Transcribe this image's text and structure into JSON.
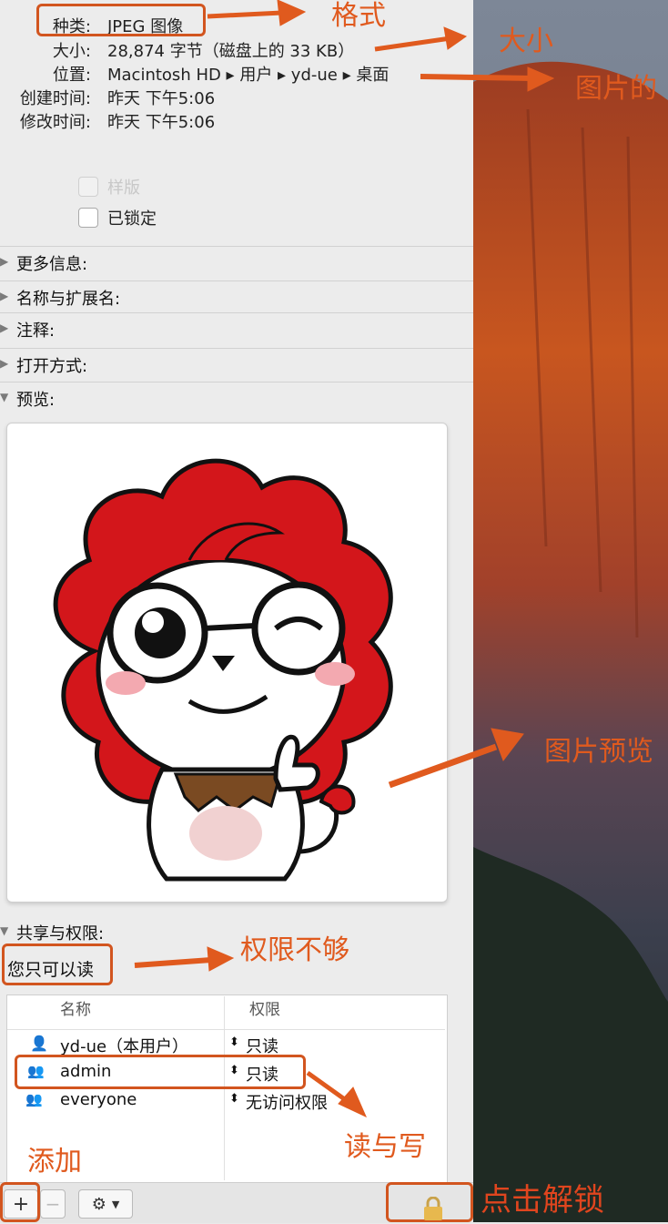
{
  "info": {
    "kind_label": "种类:",
    "kind_value": "JPEG 图像",
    "size_label": "大小:",
    "size_value": "28,874 字节（磁盘上的 33 KB）",
    "where_label": "位置:",
    "where_value": "Macintosh HD ▸ 用户 ▸ yd-ue ▸ 桌面",
    "created_label": "创建时间:",
    "created_value": "昨天 下午5:06",
    "modified_label": "修改时间:",
    "modified_value": "昨天 下午5:06"
  },
  "checks": {
    "stationery": "样版",
    "locked": "已锁定"
  },
  "sections": {
    "more_info": "更多信息:",
    "name_ext": "名称与扩展名:",
    "comments": "注释:",
    "open_with": "打开方式:",
    "preview": "预览:",
    "sharing": "共享与权限:"
  },
  "sharing": {
    "status": "您只可以读",
    "col_name": "名称",
    "col_priv": "权限",
    "rows": [
      {
        "name": "yd-ue（本用户）",
        "priv": "只读",
        "icon": "user-icon"
      },
      {
        "name": "admin",
        "priv": "只读",
        "icon": "group-icon"
      },
      {
        "name": "everyone",
        "priv": "无访问权限",
        "icon": "everyone-icon"
      }
    ]
  },
  "toolbar": {
    "add": "+",
    "remove": "−",
    "gear_menu": "gear-icon",
    "lock": "lock-icon"
  },
  "annotations": {
    "format": "格式",
    "size": "大小",
    "location": "图片的",
    "preview": "图片预览",
    "insufficient": "权限不够",
    "read_write": "读与写",
    "add": "添加",
    "unlock": "点击解锁"
  },
  "colors": {
    "annotation": "#e05a1e",
    "panel": "#ececec"
  }
}
